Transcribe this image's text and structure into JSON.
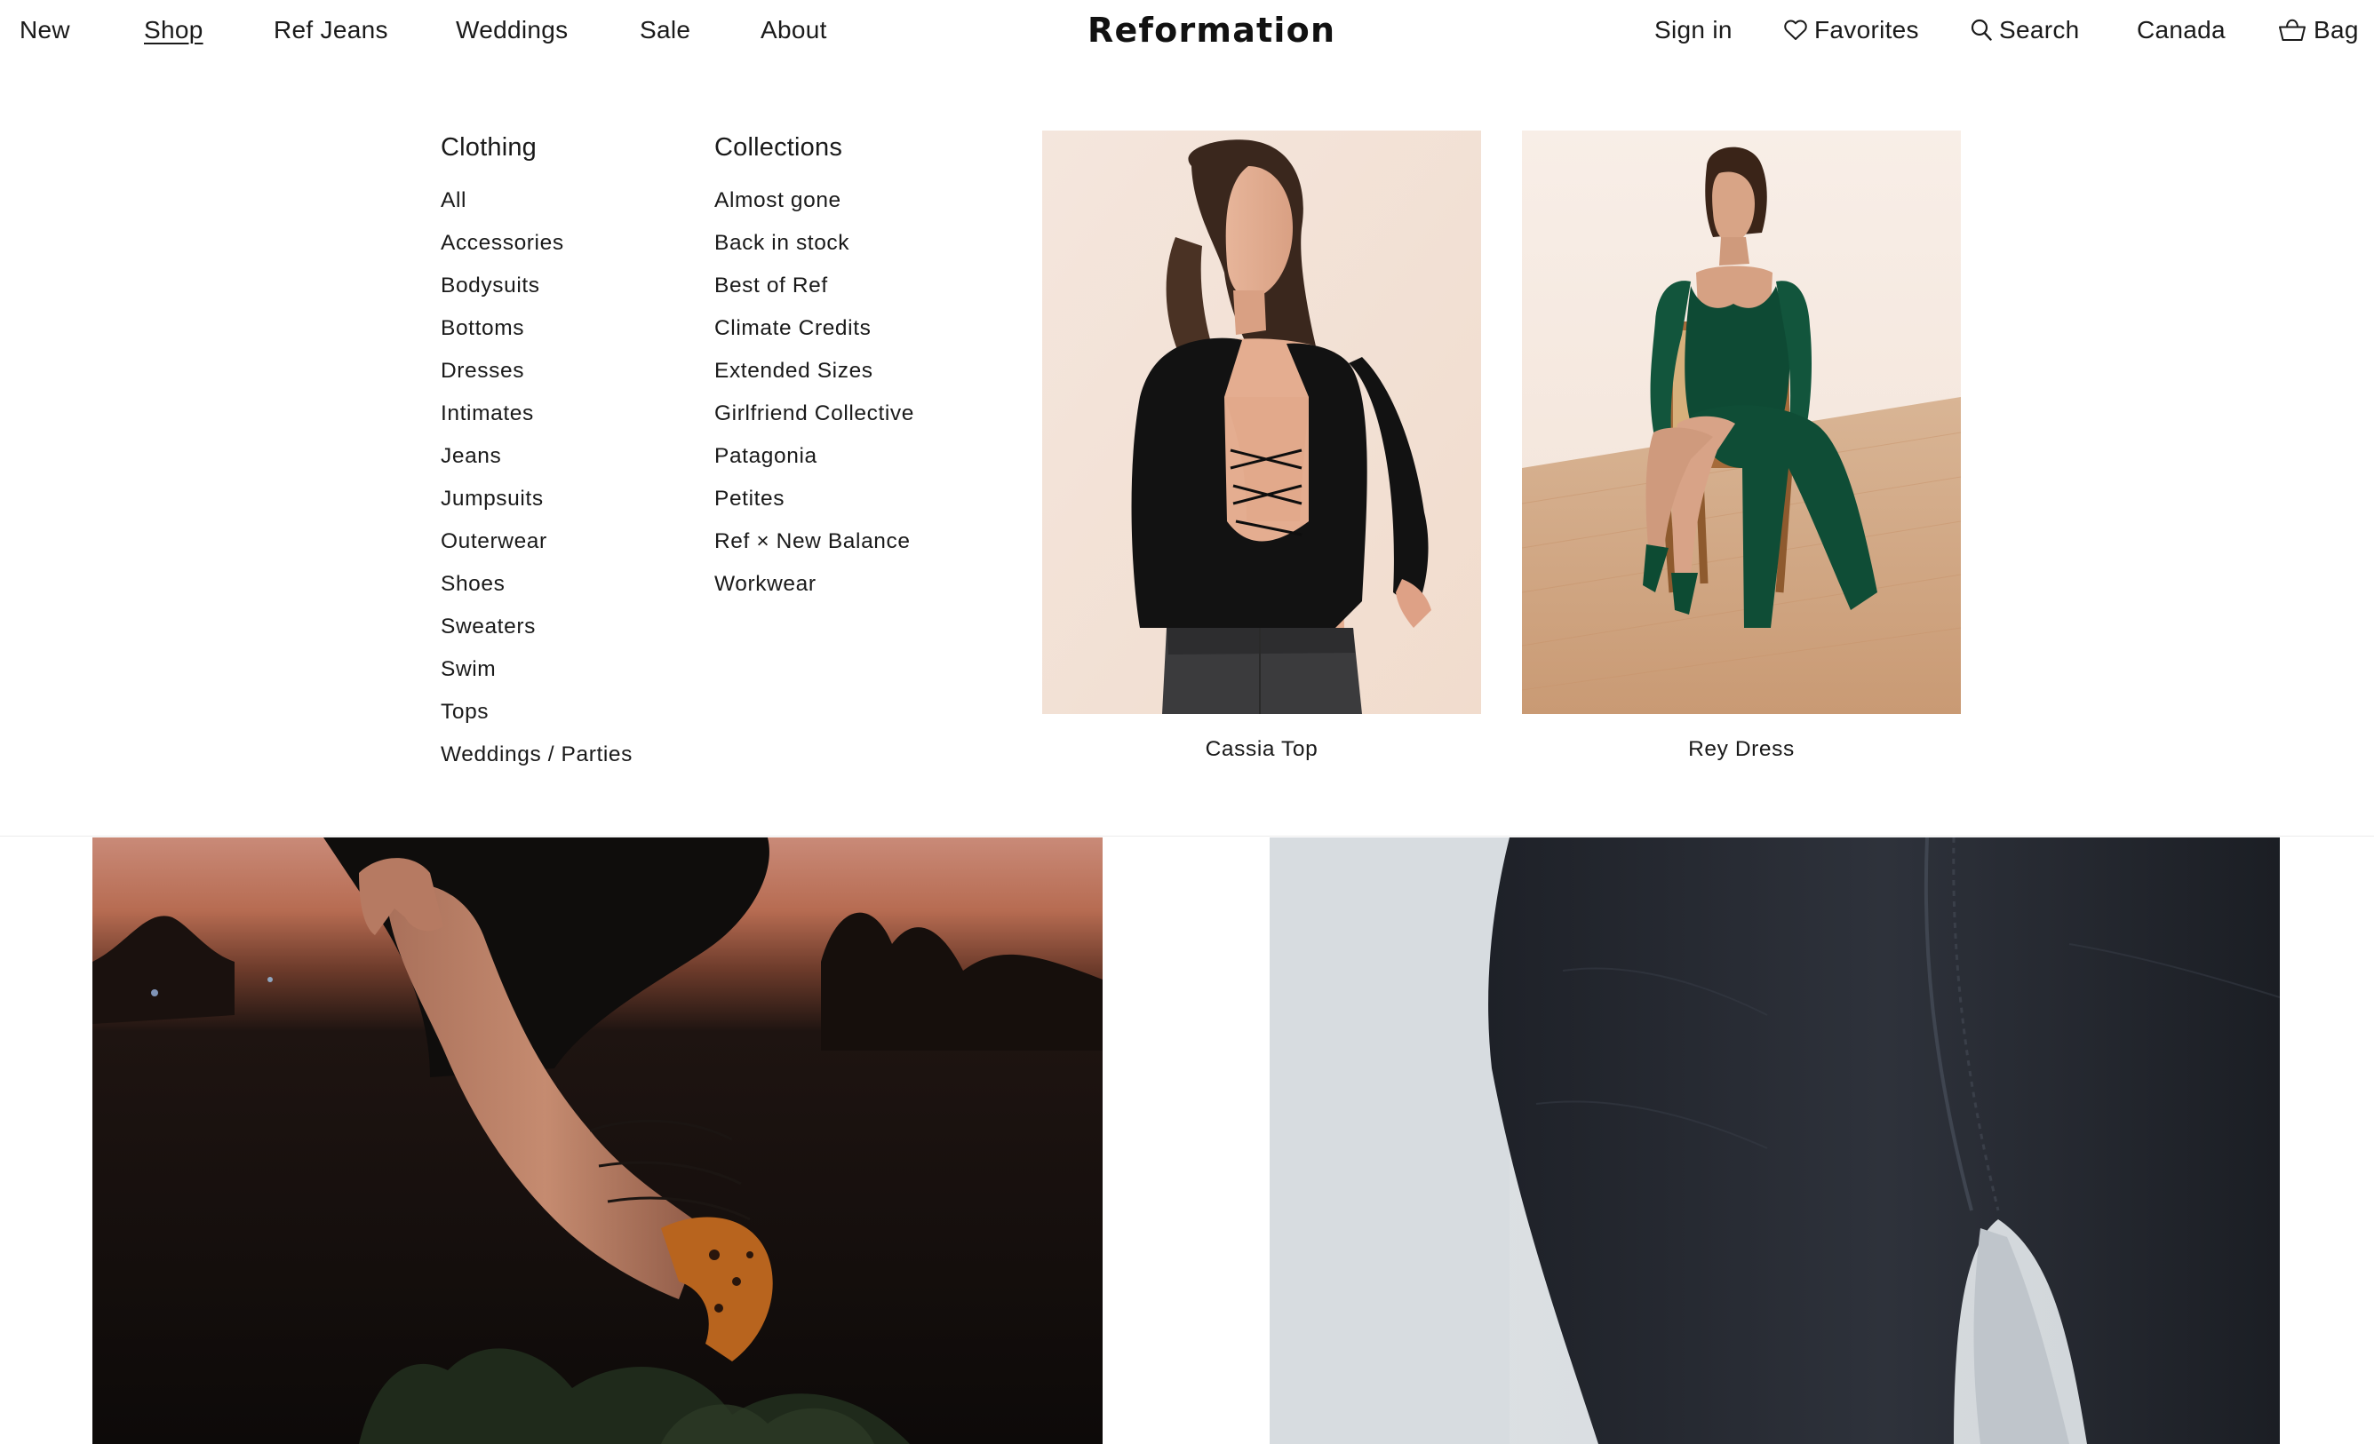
{
  "header": {
    "nav_left": [
      {
        "label": "New"
      },
      {
        "label": "Shop",
        "active": true
      },
      {
        "label": "Ref Jeans"
      },
      {
        "label": "Weddings"
      },
      {
        "label": "Sale"
      },
      {
        "label": "About"
      }
    ],
    "logo": "Reformation",
    "nav_right": {
      "sign_in": "Sign in",
      "favorites": "Favorites",
      "search": "Search",
      "region": "Canada",
      "bag": "Bag"
    },
    "icons": {
      "favorites": "heart-icon",
      "search": "search-icon",
      "bag": "bag-icon"
    }
  },
  "mega_menu": {
    "clothing": {
      "heading": "Clothing",
      "items": [
        "All",
        "Accessories",
        "Bodysuits",
        "Bottoms",
        "Dresses",
        "Intimates",
        "Jeans",
        "Jumpsuits",
        "Outerwear",
        "Shoes",
        "Sweaters",
        "Swim",
        "Tops",
        "Weddings / Parties"
      ]
    },
    "collections": {
      "heading": "Collections",
      "items": [
        "Almost gone",
        "Back in stock",
        "Best of Ref",
        "Climate Credits",
        "Extended Sizes",
        "Girlfriend Collective",
        "Patagonia",
        "Petites",
        "Ref × New Balance",
        "Workwear"
      ]
    },
    "features": [
      {
        "caption": "Cassia Top"
      },
      {
        "caption": "Rey Dress"
      }
    ]
  },
  "colors": {
    "text": "#1a1a1a",
    "background": "#ffffff",
    "divider": "#ececec"
  }
}
